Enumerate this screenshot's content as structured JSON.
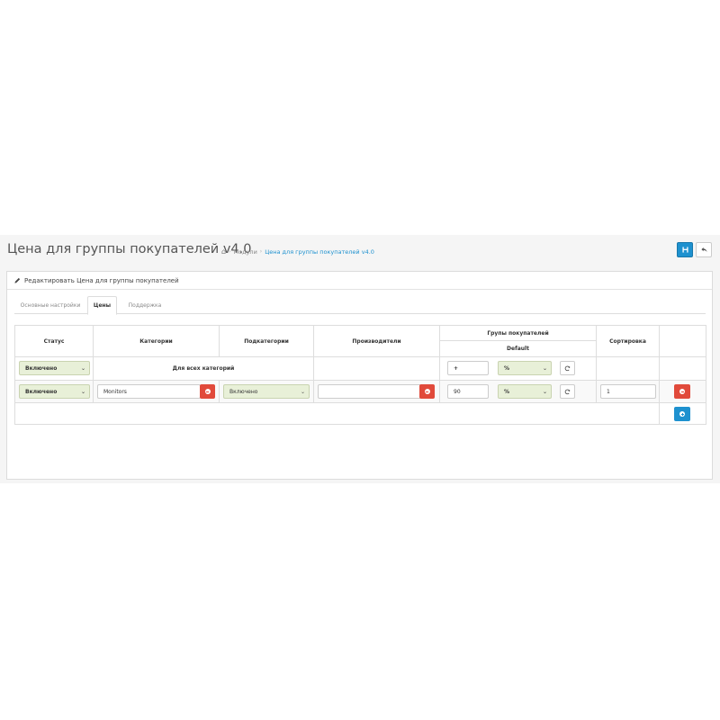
{
  "header": {
    "title": "Цена для группы покупателей v4.0",
    "breadcrumb": [
      "Модули",
      "Цена для группы покупателей v4.0"
    ]
  },
  "panel": {
    "heading": "Редактировать Цена для группы покупателей"
  },
  "tabs": [
    {
      "label": "Основные настройки",
      "active": false
    },
    {
      "label": "Цены",
      "active": true
    },
    {
      "label": "Поддержка",
      "active": false
    }
  ],
  "table": {
    "headers": {
      "status": "Статус",
      "categories": "Категории",
      "subcategories": "Подкатегории",
      "manufacturers": "Производители",
      "groups": "Групы покупателей",
      "group_default": "Default",
      "sort": "Сортировка"
    },
    "row_all": {
      "status": "Включено",
      "label": "Для всех категорий",
      "value": "+",
      "type": "%"
    },
    "row_1": {
      "status": "Включено",
      "category": "Monitors",
      "subcategory": "Включено",
      "manufacturer": "",
      "value": "90",
      "type": "%",
      "sort": "1"
    }
  },
  "colors": {
    "primary": "#1e91cf",
    "danger": "#e14a3b",
    "select_bg": "#e8f0d8"
  }
}
